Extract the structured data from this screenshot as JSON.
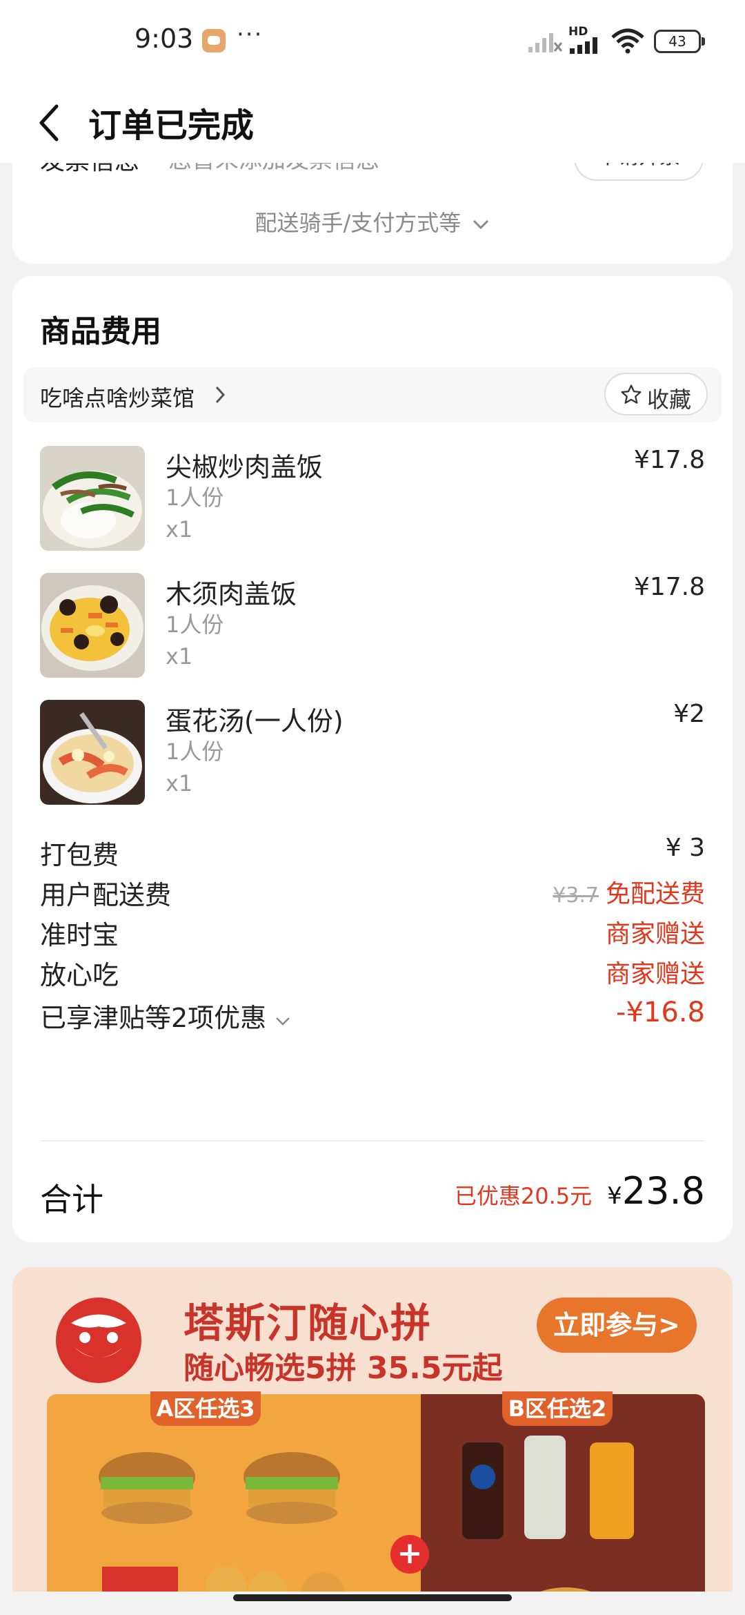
{
  "status_bar": {
    "time": "9:03",
    "dots": "···",
    "network_label": "HD",
    "battery": "43"
  },
  "header": {
    "title": "订单已完成"
  },
  "order_info": {
    "invoice_label": "发票信息",
    "invoice_value": "您暂未添加发票信息",
    "invoice_button": "申请开票",
    "more_label": "配送骑手/支付方式等"
  },
  "goods": {
    "section_title": "商品费用",
    "shop_name": "吃啥点啥炒菜馆",
    "favorite_label": "收藏",
    "items": [
      {
        "name": "尖椒炒肉盖饭",
        "spec": "1人份",
        "qty": "x1",
        "price": "¥17.8"
      },
      {
        "name": "木须肉盖饭",
        "spec": "1人份",
        "qty": "x1",
        "price": "¥17.8"
      },
      {
        "name": "蛋花汤(一人份)",
        "spec": "1人份",
        "qty": "x1",
        "price": "¥2"
      }
    ],
    "fees": {
      "packing_label": "打包费",
      "packing_value": "¥ 3",
      "delivery_label": "用户配送费",
      "delivery_original": "¥3.7",
      "delivery_value": "免配送费",
      "ontime_label": "准时宝",
      "ontime_value": "商家赠送",
      "safe_label": "放心吃",
      "safe_value": "商家赠送",
      "discount_label": "已享津贴等2项优惠",
      "discount_value": "-¥16.8"
    },
    "total": {
      "label": "合计",
      "saved": "已优惠20.5元",
      "currency": "¥",
      "value": "23.8"
    }
  },
  "ad": {
    "title": "塔斯汀随心拼",
    "subtitle": "随心畅选5拼 35.5元起",
    "button": "立即参与>",
    "zone_a": "A区任选3",
    "zone_b": "B区任选2",
    "plus": "+"
  },
  "colors": {
    "accent_red": "#e2371c",
    "ad_orange": "#e8762a"
  }
}
